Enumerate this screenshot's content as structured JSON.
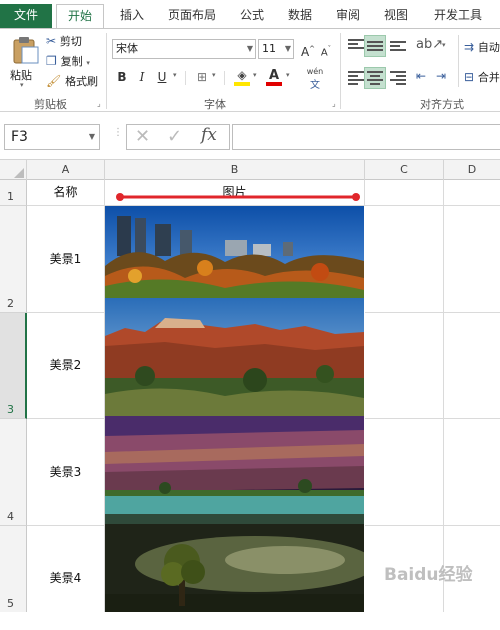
{
  "tabs": [
    "文件",
    "开始",
    "插入",
    "页面布局",
    "公式",
    "数据",
    "审阅",
    "视图",
    "开发工具"
  ],
  "ribbon": {
    "clipboard": {
      "paste": "粘贴",
      "cut": "剪切",
      "copy": "复制",
      "format_painter": "格式刷",
      "label": "剪贴板"
    },
    "font": {
      "name": "宋体",
      "size": "11",
      "bold": "B",
      "italic": "I",
      "underline": "U",
      "phonetic": "wén",
      "label": "字体",
      "grow": "A",
      "shrink": "A"
    },
    "alignment": {
      "wrap": "自动",
      "merge": "合并",
      "label": "对齐方式"
    }
  },
  "formula_bar": {
    "name_box": "F3",
    "fx": "fx",
    "value": ""
  },
  "columns": [
    "A",
    "B",
    "C",
    "D"
  ],
  "rows": [
    {
      "num": "1",
      "a": "名称",
      "b": "图片"
    },
    {
      "num": "2",
      "a": "美景1",
      "b": ""
    },
    {
      "num": "3",
      "a": "美景2",
      "b": ""
    },
    {
      "num": "4",
      "a": "美景3",
      "b": ""
    },
    {
      "num": "5",
      "a": "美景4",
      "b": ""
    }
  ],
  "colors": {
    "excel_green": "#217346",
    "arrow_red": "#e0262b",
    "selected_row": "#e1e1e1"
  },
  "watermark": "Baidu经验"
}
